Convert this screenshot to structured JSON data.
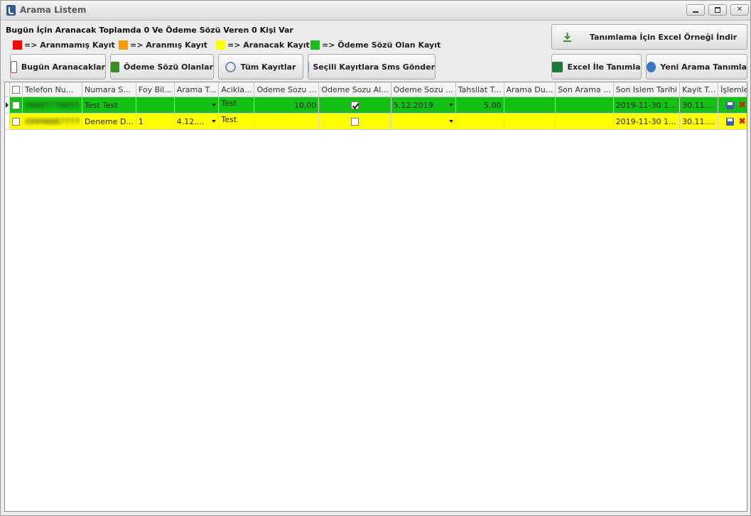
{
  "window": {
    "title": "Arama Listem"
  },
  "summary": "Bugün İçin Aranacak Toplamda 0 Ve Ödeme Sözü Veren 0 Kişi Var",
  "legend": [
    {
      "color": "#ff0000",
      "label": "=> Aranmamış Kayıt"
    },
    {
      "color": "#ff9900",
      "label": "=> Aranmış Kayıt"
    },
    {
      "color": "#ffff00",
      "label": "=> Aranacak Kayıt"
    },
    {
      "color": "#14c014",
      "label": "=> Ödeme Sözü Olan Kayıt"
    }
  ],
  "toolbar": {
    "today_calls": "Bugün Aranacaklar",
    "payment_promised": "Ödeme Sözü Olanlar",
    "all_records": "Tüm Kayıtlar",
    "send_sms": "Seçili Kayıtlara Sms Gönder",
    "excel_sample": "Tanımlama İçin Excel Örneği İndir",
    "excel_define": "Excel İle Tanımla",
    "new_call": "Yeni Arama Tanımla"
  },
  "grid": {
    "columns": [
      "Telefon Nu...",
      "Numara S...",
      "Foy Bil...",
      "Arama T...",
      "Acikla...",
      "Odeme Sozu ...",
      "Odeme Sozu Al...",
      "Odeme Sozu ...",
      "Tahsilat T...",
      "Arama Du...",
      "Son Arama ...",
      "Son Islem Tarihi",
      "Kayit T...",
      "İşlemler"
    ],
    "rows": [
      {
        "phone": "08887778655",
        "name": "Test Test",
        "foy": "",
        "arama_t": "",
        "aciklama": "Test",
        "odeme_sozu": "10,00",
        "odeme_alindi": true,
        "odeme_tarihi": "5.12.2019",
        "tahsilat": "5,00",
        "arama_du": "",
        "son_arama": "",
        "son_islem": "2019-11-30 1...",
        "kayit": "30.11....",
        "color": "green"
      },
      {
        "phone": "09998887777",
        "name": "Deneme D...",
        "foy": "1",
        "arama_t": "4.12....",
        "aciklama": "Test",
        "odeme_sozu": "",
        "odeme_alindi": false,
        "odeme_tarihi": "",
        "tahsilat": "",
        "arama_du": "",
        "son_arama": "",
        "son_islem": "2019-11-30 1...",
        "kayit": "30.11....",
        "color": "yellow"
      }
    ]
  }
}
